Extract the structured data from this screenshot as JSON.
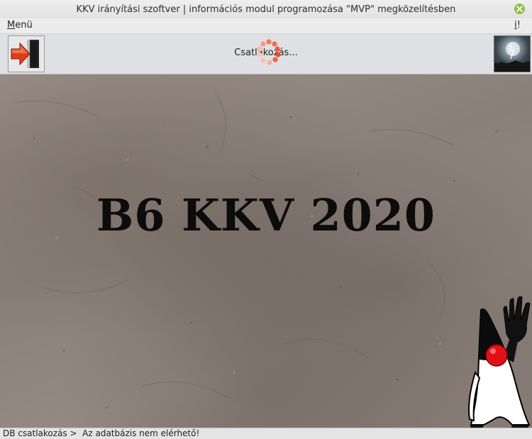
{
  "window": {
    "title": "KKV irányítási szoftver | információs modul programozása \"MVP\" megközelítésben",
    "close_icon": "close-icon",
    "accent_color": "#8cbf3f"
  },
  "menubar": {
    "menu_first": "M",
    "menu_rest": "enü",
    "info_first": "i",
    "info_rest": "!"
  },
  "toolbar": {
    "exit_icon": "exit-door-arrow-icon",
    "status_text": "Csatlakozás...",
    "spinner_icon": "loading-spinner-icon",
    "status_image": "storm-image-icon"
  },
  "main": {
    "heading": "B6 KKV 2020",
    "mascot_icon": "java-duke-mascot-icon"
  },
  "statusbar": {
    "text": "DB csatlakozás >  Az adatbázis nem elérhető!"
  }
}
